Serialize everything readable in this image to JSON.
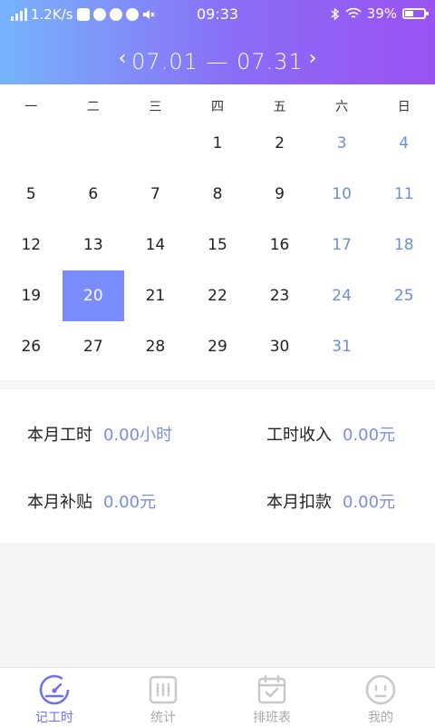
{
  "status_bar": {
    "speed": "1.2K/s",
    "time": "09:33",
    "battery": "39%",
    "battery_level": 0.39
  },
  "header": {
    "prev_label": "‹",
    "next_label": "›",
    "range": "07.01 — 07.31"
  },
  "calendar": {
    "weekdays": [
      "一",
      "二",
      "三",
      "四",
      "五",
      "六",
      "日"
    ],
    "leading_blanks": 3,
    "days": [
      "1",
      "2",
      "3",
      "4",
      "5",
      "6",
      "7",
      "8",
      "9",
      "10",
      "11",
      "12",
      "13",
      "14",
      "15",
      "16",
      "17",
      "18",
      "19",
      "20",
      "21",
      "22",
      "23",
      "24",
      "25",
      "26",
      "27",
      "28",
      "29",
      "30",
      "31"
    ],
    "selected_day": "20",
    "weekend_color": "#6b8fd6",
    "selected_color": "#7b8cff"
  },
  "summary": {
    "month_hours": {
      "label": "本月工时",
      "value": "0.00小时"
    },
    "hour_income": {
      "label": "工时收入",
      "value": "0.00元"
    },
    "month_allowance": {
      "label": "本月补贴",
      "value": "0.00元"
    },
    "month_deduction": {
      "label": "本月扣款",
      "value": "0.00元"
    }
  },
  "tabbar": {
    "active_color": "#6a6ff0",
    "tabs": [
      {
        "label": "记工时",
        "icon": "gauge-icon"
      },
      {
        "label": "统计",
        "icon": "stats-icon"
      },
      {
        "label": "排班表",
        "icon": "schedule-icon"
      },
      {
        "label": "我的",
        "icon": "face-icon"
      }
    ]
  }
}
